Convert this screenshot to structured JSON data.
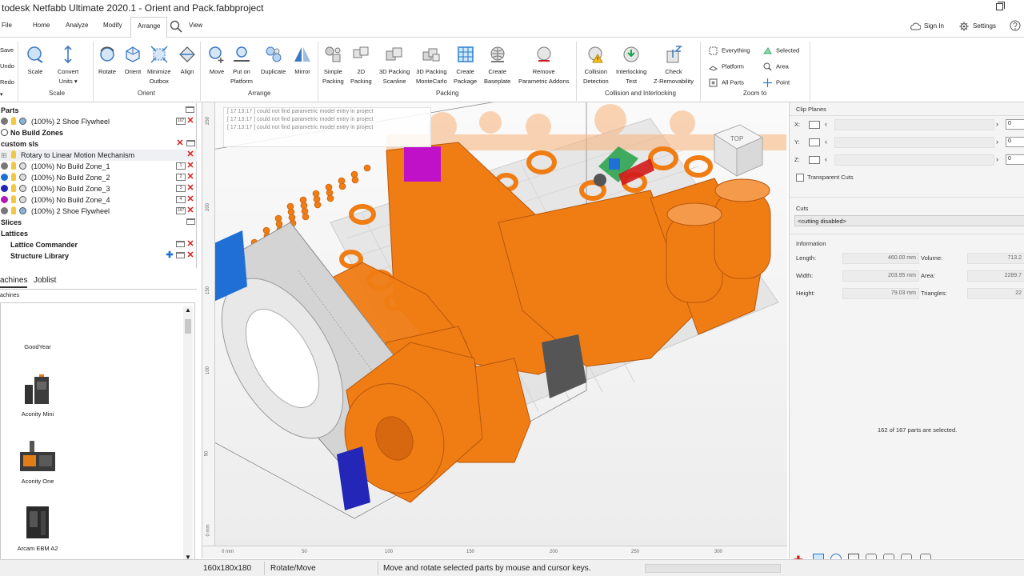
{
  "window": {
    "title": "todesk Netfabb Ultimate 2020.1 - Orient and Pack.fabbproject"
  },
  "tabs": [
    {
      "label": "File"
    },
    {
      "label": "Home"
    },
    {
      "label": "Analyze"
    },
    {
      "label": "Modify"
    },
    {
      "label": "Arrange"
    },
    {
      "label": "View"
    }
  ],
  "header_right": {
    "sign_in": "Sign In",
    "settings": "Settings"
  },
  "ribbon": {
    "left_edge": [
      "Save",
      "Undo",
      "Redo"
    ],
    "scale": "Scale",
    "convert_units_1": "Convert",
    "convert_units_2": "Units",
    "rotate": "Rotate",
    "orient": "Orient",
    "minimize_outbox_1": "Minimize",
    "minimize_outbox_2": "Outbox",
    "align": "Align",
    "move": "Move",
    "put_on_platform_1": "Put on",
    "put_on_platform_2": "Platform",
    "duplicate": "Duplicate",
    "mirror": "Mirror",
    "simple_packing_1": "Simple",
    "simple_packing_2": "Packing",
    "packing_2d_1": "2D",
    "packing_2d_2": "Packing",
    "packing_3d_scanline_1": "3D Packing",
    "packing_3d_scanline_2": "Scanline",
    "packing_3d_montecarlo_1": "3D Packing",
    "packing_3d_montecarlo_2": "MonteCarlo",
    "create_package_1": "Create",
    "create_package_2": "Package",
    "create_baseplate_1": "Create",
    "create_baseplate_2": "Baseplate",
    "remove_addons_1": "Remove",
    "remove_addons_2": "Parametric Addons",
    "collision_1": "Collision",
    "collision_2": "Detection",
    "interlocking_1": "Interlocking",
    "interlocking_2": "Test",
    "check_z_1": "Check",
    "check_z_2": "Z-Removability",
    "zoom_everything": "Everything",
    "zoom_selected": "Selected",
    "zoom_platform": "Platform",
    "zoom_area": "Area",
    "zoom_all_parts": "All Parts",
    "zoom_point": "Point",
    "groups": {
      "scale": "Scale",
      "orient": "Orient",
      "arrange": "Arrange",
      "packing": "Packing",
      "collision": "Collision and Interlocking",
      "zoom": "Zoom to"
    }
  },
  "tree": {
    "parts_header": "Parts",
    "part1": "(100%) 2 Shoe Flywheel",
    "no_build_zones": "No Build Zones",
    "custom_sls": "custom sls",
    "rotary": "Rotary to Linear Motion Mechanism",
    "zone1": "(100%) No Build Zone_1",
    "zone2": "(100%) No Build Zone_2",
    "zone3": "(100%) No Build Zone_3",
    "zone4": "(100%) No Build Zone_4",
    "flywheel2": "(100%) 2 Shoe Flywheel",
    "slices": "Slices",
    "lattices": "Lattices",
    "lattice_commander": "Lattice Commander",
    "structure_library": "Structure Library",
    "badges": [
      "167",
      "1",
      "2",
      "3",
      "4",
      "167"
    ]
  },
  "machines": {
    "tab_machines": "achines",
    "tab_joblist": "Joblist",
    "header": "achines",
    "items": [
      "GoodYear",
      "Aconity Mini",
      "Aconity One",
      "Arcam EBM A2"
    ]
  },
  "viewport": {
    "log": [
      "[ 17:13:17 ] could not find parametric model entry in project",
      "[ 17:13:17 ] could not find parametric model entry in project",
      "[ 17:13:17 ] could not find parametric model entry in project"
    ],
    "x_ticks": [
      "0 mm",
      "50",
      "100",
      "150",
      "200",
      "250",
      "300"
    ],
    "y_ticks": [
      "250",
      "200",
      "150",
      "100",
      "50",
      "0 mm"
    ],
    "viewcube_label": "TOP"
  },
  "right_panel": {
    "clip_planes": "Clip Planes",
    "x": "X:",
    "y": "Y:",
    "z": "Z:",
    "x_val": "0",
    "y_val": "0",
    "z_val": "0",
    "transparent_cuts": "Transparent Cuts",
    "cuts": "Cuts",
    "cuts_value": "<cutting disabled>",
    "information": "Information",
    "length_label": "Length:",
    "length_value": "460.00 mm",
    "volume_label": "Volume:",
    "volume_value": "713.2",
    "width_label": "Width:",
    "width_value": "203.95 mm",
    "area_label": "Area:",
    "area_value": "2289.7",
    "height_label": "Height:",
    "height_value": "79.03 mm",
    "triangles_label": "Triangles:",
    "triangles_value": "22",
    "selection_status": "162 of 167 parts are selected."
  },
  "status": {
    "size": "160x180x180",
    "mode": "Rotate/Move",
    "hint": "Move and rotate selected parts by mouse and cursor keys."
  },
  "colors": {
    "accent": "#1f6fc7",
    "part_orange": "#f07d14",
    "delete_red": "#d21b1b",
    "magenta": "#c010c8"
  }
}
